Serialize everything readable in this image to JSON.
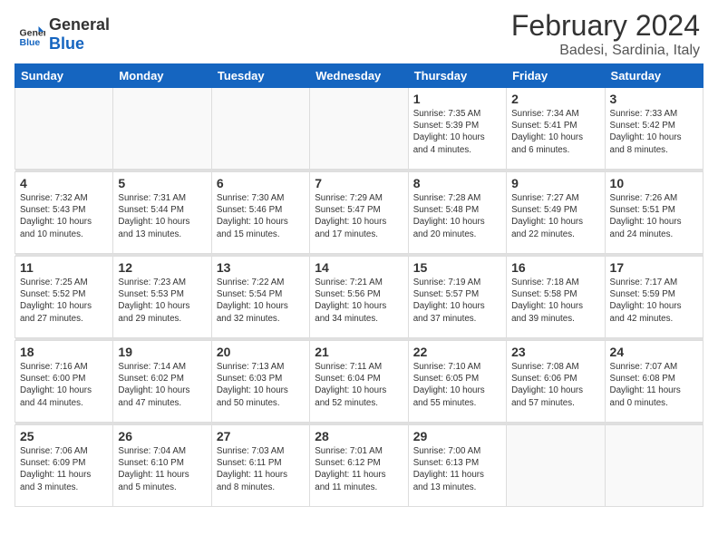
{
  "header": {
    "logo_general": "General",
    "logo_blue": "Blue",
    "month_year": "February 2024",
    "location": "Badesi, Sardinia, Italy"
  },
  "days_of_week": [
    "Sunday",
    "Monday",
    "Tuesday",
    "Wednesday",
    "Thursday",
    "Friday",
    "Saturday"
  ],
  "weeks": [
    [
      {
        "num": "",
        "info": ""
      },
      {
        "num": "",
        "info": ""
      },
      {
        "num": "",
        "info": ""
      },
      {
        "num": "",
        "info": ""
      },
      {
        "num": "1",
        "info": "Sunrise: 7:35 AM\nSunset: 5:39 PM\nDaylight: 10 hours\nand 4 minutes."
      },
      {
        "num": "2",
        "info": "Sunrise: 7:34 AM\nSunset: 5:41 PM\nDaylight: 10 hours\nand 6 minutes."
      },
      {
        "num": "3",
        "info": "Sunrise: 7:33 AM\nSunset: 5:42 PM\nDaylight: 10 hours\nand 8 minutes."
      }
    ],
    [
      {
        "num": "4",
        "info": "Sunrise: 7:32 AM\nSunset: 5:43 PM\nDaylight: 10 hours\nand 10 minutes."
      },
      {
        "num": "5",
        "info": "Sunrise: 7:31 AM\nSunset: 5:44 PM\nDaylight: 10 hours\nand 13 minutes."
      },
      {
        "num": "6",
        "info": "Sunrise: 7:30 AM\nSunset: 5:46 PM\nDaylight: 10 hours\nand 15 minutes."
      },
      {
        "num": "7",
        "info": "Sunrise: 7:29 AM\nSunset: 5:47 PM\nDaylight: 10 hours\nand 17 minutes."
      },
      {
        "num": "8",
        "info": "Sunrise: 7:28 AM\nSunset: 5:48 PM\nDaylight: 10 hours\nand 20 minutes."
      },
      {
        "num": "9",
        "info": "Sunrise: 7:27 AM\nSunset: 5:49 PM\nDaylight: 10 hours\nand 22 minutes."
      },
      {
        "num": "10",
        "info": "Sunrise: 7:26 AM\nSunset: 5:51 PM\nDaylight: 10 hours\nand 24 minutes."
      }
    ],
    [
      {
        "num": "11",
        "info": "Sunrise: 7:25 AM\nSunset: 5:52 PM\nDaylight: 10 hours\nand 27 minutes."
      },
      {
        "num": "12",
        "info": "Sunrise: 7:23 AM\nSunset: 5:53 PM\nDaylight: 10 hours\nand 29 minutes."
      },
      {
        "num": "13",
        "info": "Sunrise: 7:22 AM\nSunset: 5:54 PM\nDaylight: 10 hours\nand 32 minutes."
      },
      {
        "num": "14",
        "info": "Sunrise: 7:21 AM\nSunset: 5:56 PM\nDaylight: 10 hours\nand 34 minutes."
      },
      {
        "num": "15",
        "info": "Sunrise: 7:19 AM\nSunset: 5:57 PM\nDaylight: 10 hours\nand 37 minutes."
      },
      {
        "num": "16",
        "info": "Sunrise: 7:18 AM\nSunset: 5:58 PM\nDaylight: 10 hours\nand 39 minutes."
      },
      {
        "num": "17",
        "info": "Sunrise: 7:17 AM\nSunset: 5:59 PM\nDaylight: 10 hours\nand 42 minutes."
      }
    ],
    [
      {
        "num": "18",
        "info": "Sunrise: 7:16 AM\nSunset: 6:00 PM\nDaylight: 10 hours\nand 44 minutes."
      },
      {
        "num": "19",
        "info": "Sunrise: 7:14 AM\nSunset: 6:02 PM\nDaylight: 10 hours\nand 47 minutes."
      },
      {
        "num": "20",
        "info": "Sunrise: 7:13 AM\nSunset: 6:03 PM\nDaylight: 10 hours\nand 50 minutes."
      },
      {
        "num": "21",
        "info": "Sunrise: 7:11 AM\nSunset: 6:04 PM\nDaylight: 10 hours\nand 52 minutes."
      },
      {
        "num": "22",
        "info": "Sunrise: 7:10 AM\nSunset: 6:05 PM\nDaylight: 10 hours\nand 55 minutes."
      },
      {
        "num": "23",
        "info": "Sunrise: 7:08 AM\nSunset: 6:06 PM\nDaylight: 10 hours\nand 57 minutes."
      },
      {
        "num": "24",
        "info": "Sunrise: 7:07 AM\nSunset: 6:08 PM\nDaylight: 11 hours\nand 0 minutes."
      }
    ],
    [
      {
        "num": "25",
        "info": "Sunrise: 7:06 AM\nSunset: 6:09 PM\nDaylight: 11 hours\nand 3 minutes."
      },
      {
        "num": "26",
        "info": "Sunrise: 7:04 AM\nSunset: 6:10 PM\nDaylight: 11 hours\nand 5 minutes."
      },
      {
        "num": "27",
        "info": "Sunrise: 7:03 AM\nSunset: 6:11 PM\nDaylight: 11 hours\nand 8 minutes."
      },
      {
        "num": "28",
        "info": "Sunrise: 7:01 AM\nSunset: 6:12 PM\nDaylight: 11 hours\nand 11 minutes."
      },
      {
        "num": "29",
        "info": "Sunrise: 7:00 AM\nSunset: 6:13 PM\nDaylight: 11 hours\nand 13 minutes."
      },
      {
        "num": "",
        "info": ""
      },
      {
        "num": "",
        "info": ""
      }
    ]
  ]
}
